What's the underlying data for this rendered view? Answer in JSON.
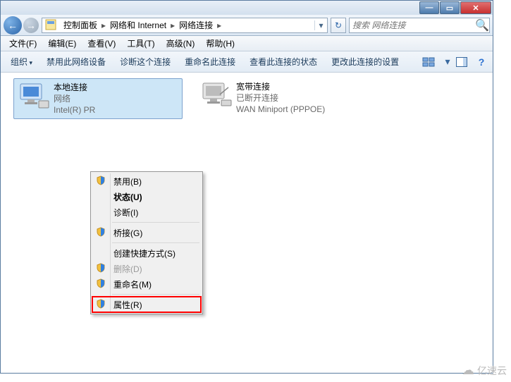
{
  "titlebar": {
    "min": "—",
    "max": "▭",
    "close": "✕"
  },
  "nav": {
    "back": "←",
    "fwd": "→",
    "refresh": "↻",
    "drop": "▾"
  },
  "breadcrumb": [
    "控制面板",
    "网络和 Internet",
    "网络连接"
  ],
  "search": {
    "placeholder": "搜索 网络连接"
  },
  "menubar": [
    "文件(F)",
    "编辑(E)",
    "查看(V)",
    "工具(T)",
    "高级(N)",
    "帮助(H)"
  ],
  "toolbar": {
    "organize": "组织",
    "items": [
      "禁用此网络设备",
      "诊断这个连接",
      "重命名此连接",
      "查看此连接的状态",
      "更改此连接的设置"
    ]
  },
  "connections": [
    {
      "name": "本地连接",
      "status": "网络",
      "device": "Intel(R) PR",
      "selected": true
    },
    {
      "name": "宽带连接",
      "status": "已断开连接",
      "device": "WAN Miniport (PPPOE)",
      "selected": false
    }
  ],
  "context_menu": [
    {
      "label": "禁用(B)",
      "shield": true,
      "bold": false,
      "disabled": false
    },
    {
      "label": "状态(U)",
      "shield": false,
      "bold": true,
      "disabled": false
    },
    {
      "label": "诊断(I)",
      "shield": false,
      "bold": false,
      "disabled": false
    },
    {
      "sep": true
    },
    {
      "label": "桥接(G)",
      "shield": true,
      "bold": false,
      "disabled": false
    },
    {
      "sep": true
    },
    {
      "label": "创建快捷方式(S)",
      "shield": false,
      "bold": false,
      "disabled": false
    },
    {
      "label": "删除(D)",
      "shield": true,
      "bold": false,
      "disabled": true
    },
    {
      "label": "重命名(M)",
      "shield": true,
      "bold": false,
      "disabled": false
    },
    {
      "sep": true
    },
    {
      "label": "属性(R)",
      "shield": true,
      "bold": false,
      "disabled": false,
      "highlight": true
    }
  ],
  "watermark": "亿速云"
}
